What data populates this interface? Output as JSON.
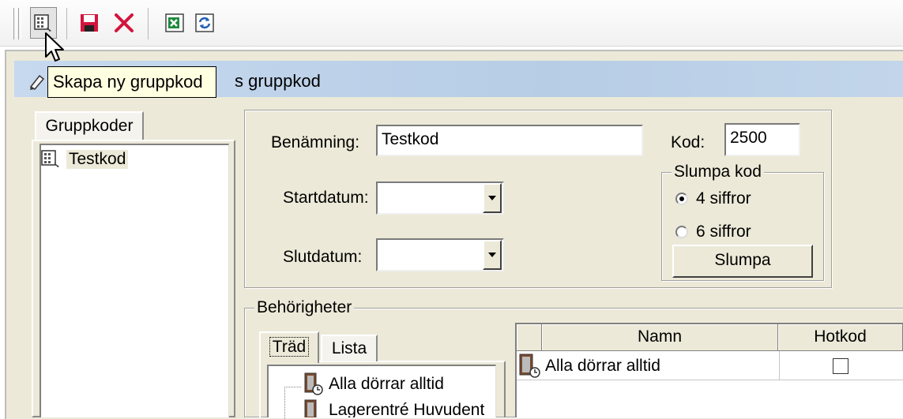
{
  "toolbar": {
    "buttons": [
      {
        "name": "new-group-code",
        "icon": "grid-new-icon"
      },
      {
        "name": "save",
        "icon": "floppy-disk-icon"
      },
      {
        "name": "delete",
        "icon": "red-x-icon"
      },
      {
        "name": "export",
        "icon": "excel-export-icon"
      },
      {
        "name": "refresh",
        "icon": "refresh-icon"
      }
    ]
  },
  "tooltip": {
    "text": "Skapa ny gruppkod"
  },
  "window": {
    "title_visible_suffix": "s gruppkod"
  },
  "left_panel": {
    "tab_label": "Gruppkoder",
    "items": [
      {
        "label": "Testkod",
        "icon": "grid-icon"
      }
    ]
  },
  "form": {
    "name_label": "Benämning:",
    "name_value": "Testkod",
    "code_label": "Kod:",
    "code_value": "2500",
    "start_label": "Startdatum:",
    "start_value": "",
    "end_label": "Slutdatum:",
    "end_value": ""
  },
  "random_code": {
    "legend": "Slumpa kod",
    "option_4": "4 siffror",
    "option_6": "6 siffror",
    "selected": "4 siffror",
    "button_label": "Slumpa"
  },
  "permissions": {
    "legend": "Behörigheter",
    "tabs": [
      {
        "label": "Träd",
        "active": true
      },
      {
        "label": "Lista",
        "active": false
      }
    ],
    "tree_items": [
      "Alla dörrar alltid",
      "Lagerentré Huvudent"
    ],
    "grid": {
      "columns": [
        "Namn",
        "Hotkod"
      ],
      "rows": [
        {
          "name": "Alla dörrar alltid",
          "hotkod": false
        }
      ]
    }
  },
  "colors": {
    "window_bg": "#ece9d8",
    "titlebar": "#b7cde6",
    "tooltip_bg": "#ffffe1",
    "accent_red": "#d4143c"
  }
}
